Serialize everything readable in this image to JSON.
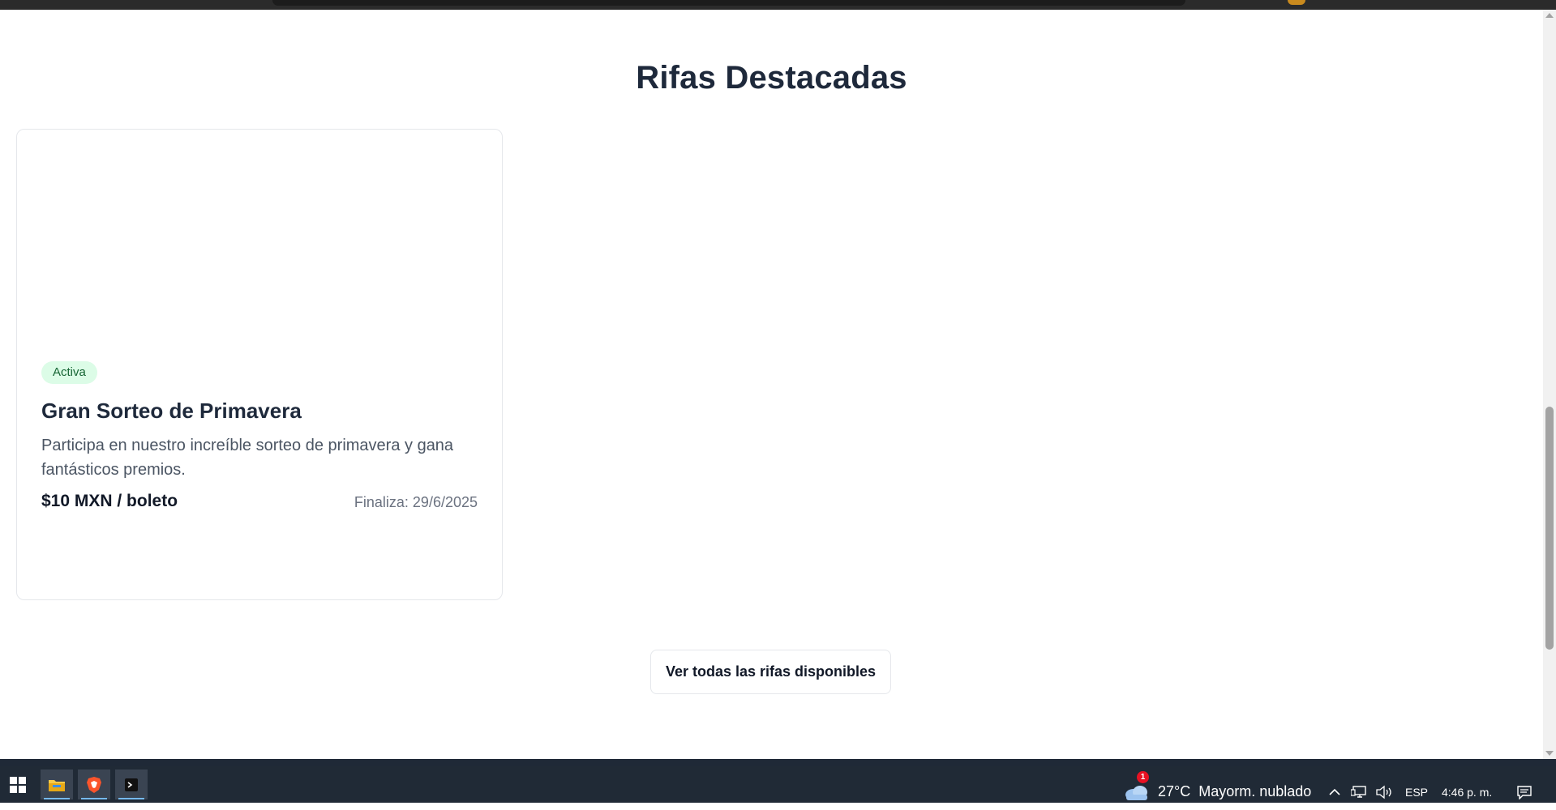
{
  "section": {
    "title": "Rifas Destacadas"
  },
  "raffle_card": {
    "status_badge": "Activa",
    "title": "Gran Sorteo de Primavera",
    "description": "Participa en nuestro increíble sorteo de primavera y gana fantásticos premios.",
    "price": "$10 MXN / boleto",
    "end_date": "Finaliza: 29/6/2025"
  },
  "actions": {
    "view_all_label": "Ver todas las rifas disponibles"
  },
  "taskbar": {
    "apps": [
      "windows-start",
      "file-explorer",
      "brave-browser",
      "terminal-app"
    ],
    "weather_badge": "1",
    "weather_temp": "27°C",
    "weather_text": "Mayorm. nublado",
    "language": "ESP",
    "clock": "4:46 p. m."
  },
  "colors": {
    "badge_bg": "#dcfce7",
    "badge_text": "#166534",
    "heading": "#1e293b",
    "taskbar": "#202a36"
  }
}
